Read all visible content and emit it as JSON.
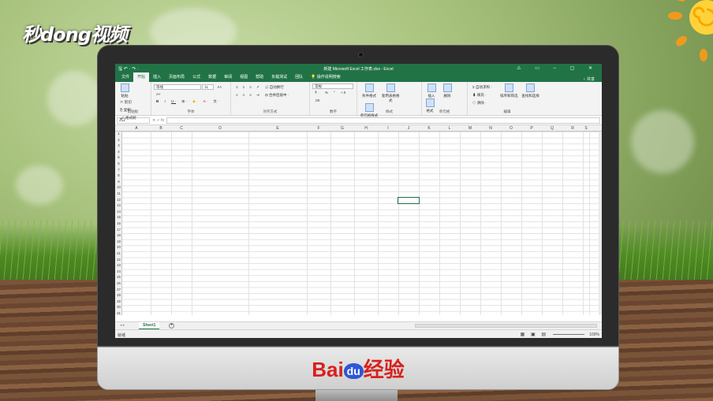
{
  "watermark": {
    "text": "秒dong视频"
  },
  "brand": {
    "text": "Bai",
    "du": "du",
    "suffix": "经验"
  },
  "excel": {
    "title": "新建 Microsoft Excel 工作表.xlsx - Excel",
    "quick_access": "🖫 ↶ · ↷ ·",
    "window_controls": "⚠ ▭ – ▢ ✕",
    "tabs": [
      "文件",
      "开始",
      "插入",
      "页面布局",
      "公式",
      "数据",
      "审阅",
      "视图",
      "帮助",
      "负载测试",
      "团队",
      "💡 操作说明搜索"
    ],
    "active_tab_index": 1,
    "share": "♀ 共享",
    "ribbon": {
      "clipboard": {
        "paste": "粘贴",
        "cut": "✂ 剪切",
        "copy": "⎘ 复制 ·",
        "format_painter": "🖌 格式刷",
        "label": "剪贴板"
      },
      "font": {
        "name": "等线",
        "size": "11",
        "grow": "A˄",
        "shrink": "A˅",
        "bold": "B",
        "italic": "I",
        "underline": "U ·",
        "border": "⊞ ·",
        "fill": "◆ ·",
        "font_color": "A ·",
        "phonetic": "文 ·",
        "label": "字体"
      },
      "alignment": {
        "wrap": "⇌ 自动换行",
        "merge": "⊟ 合并后居中 ·",
        "label": "对齐方式"
      },
      "number": {
        "format": "常规",
        "currency": "₹ ·",
        "percent": "%",
        "comma": "❜",
        "dec_inc": "+.0",
        "dec_dec": ".00",
        "label": "数字"
      },
      "styles": {
        "conditional": "条件格式",
        "as_table": "套用表格格式",
        "cell_styles": "单元格样式",
        "label": "样式"
      },
      "cells": {
        "insert": "插入",
        "delete": "删除",
        "format": "格式",
        "label": "单元格"
      },
      "editing": {
        "autosum": "Σ 自动求和 ·",
        "fill": "⬇ 填充 ·",
        "clear": "◇ 清除 ·",
        "sort": "排序和筛选",
        "find": "查找和选择",
        "label": "编辑"
      }
    },
    "name_box": "J12",
    "fx": "✕ ✓ fx",
    "columns": [
      "A",
      "B",
      "C",
      "D",
      "E",
      "F",
      "G",
      "H",
      "I",
      "J",
      "K",
      "L",
      "M",
      "N",
      "O",
      "P",
      "Q",
      "R",
      "S"
    ],
    "rows": [
      "1",
      "2",
      "3",
      "4",
      "5",
      "6",
      "7",
      "8",
      "9",
      "10",
      "11",
      "12",
      "13",
      "14",
      "15",
      "16",
      "17",
      "18",
      "19",
      "20",
      "21",
      "22",
      "23",
      "24",
      "25",
      "26",
      "27",
      "28",
      "29",
      "30",
      "31"
    ],
    "sheet_tab": "Sheet1",
    "add_sheet": "+",
    "status": "就绪",
    "view_buttons": "▦ ▣ ▤",
    "zoom": "100%"
  }
}
